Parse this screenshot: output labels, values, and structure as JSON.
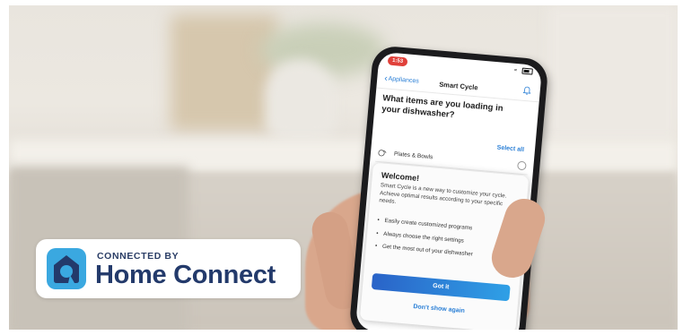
{
  "phone": {
    "status_time": "1:53",
    "nav_back_label": "Appliances",
    "nav_title": "Smart Cycle",
    "question": "What items are you loading in your dishwasher?",
    "select_all": "Select all",
    "item_label": "Plates & Bowls"
  },
  "modal": {
    "title": "Welcome!",
    "body": "Smart Cycle is a new way to customize your cycle. Achieve optimal results according to your specific needs.",
    "bullets": [
      "Easily create customized programs",
      "Always choose the right settings",
      "Get the most out of your dishwasher"
    ],
    "primary_button": "Got it",
    "secondary_button": "Don't show again"
  },
  "badge": {
    "connected_by": "CONNECTED BY",
    "brand": "Home Connect"
  },
  "colors": {
    "accent_blue": "#2a7fd6",
    "button_gradient_start": "#2a63c8",
    "button_gradient_end": "#2fa0e6",
    "time_pill": "#e0403a",
    "logo_blue": "#3aa8e0",
    "brand_navy": "#233a6b"
  },
  "icons": [
    "chevron-left-icon",
    "bell-icon",
    "wifi-icon",
    "battery-icon",
    "plates-bowls-icon",
    "radio-icon",
    "home-connect-logo-icon"
  ]
}
